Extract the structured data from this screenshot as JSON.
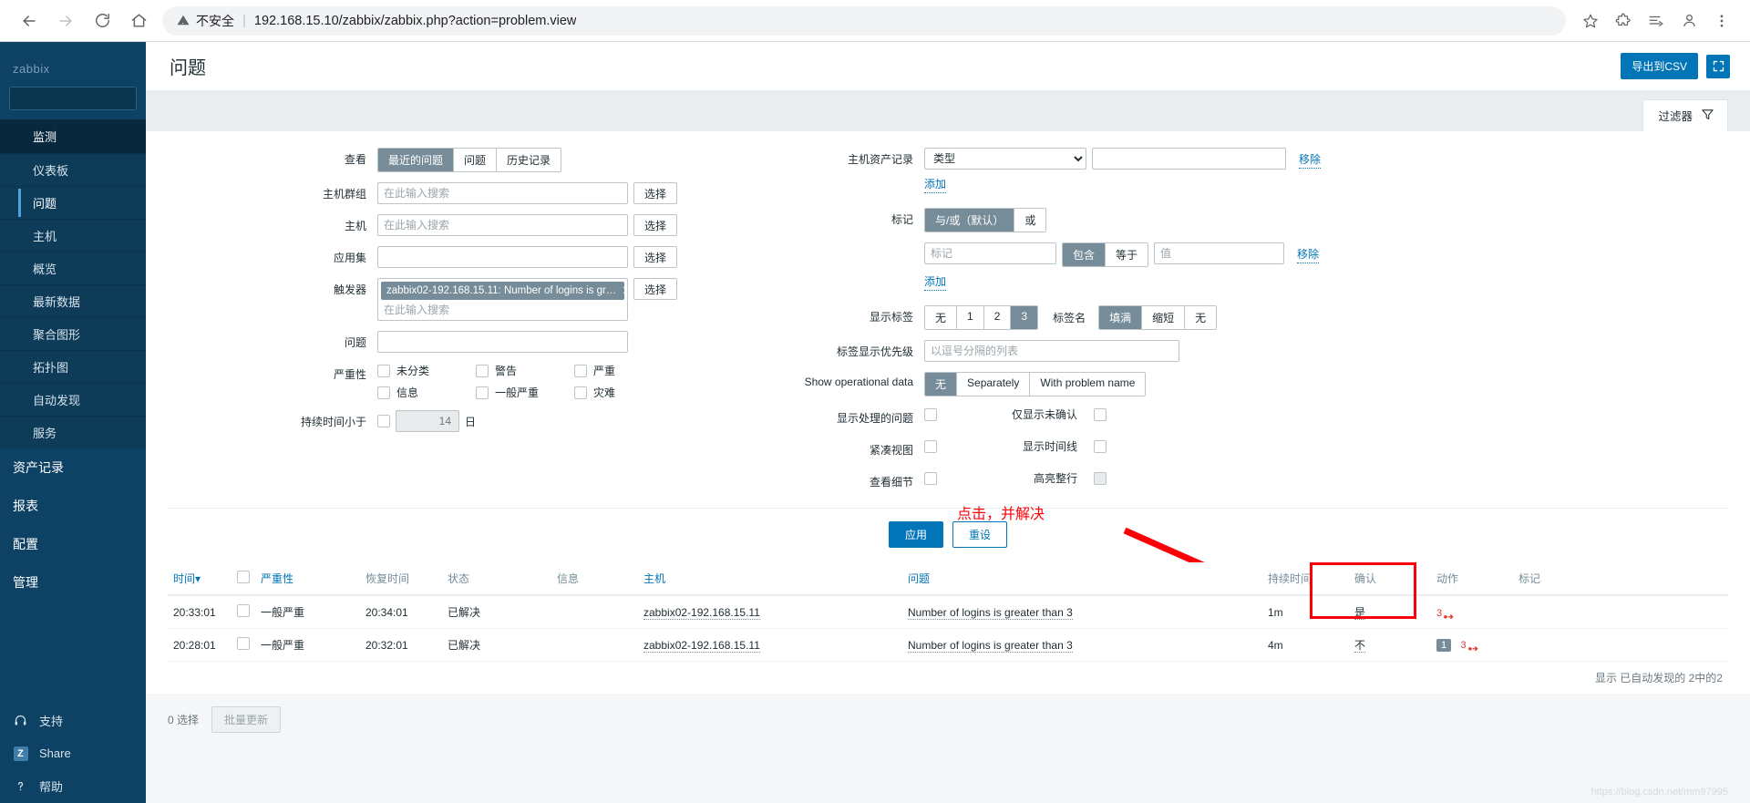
{
  "browser": {
    "back_icon": "back-arrow-icon",
    "forward_icon": "forward-arrow-icon",
    "reload_icon": "reload-icon",
    "home_icon": "home-icon",
    "warning_icon": "warning-triangle-icon",
    "security_label": "不安全",
    "url": "192.168.15.10/zabbix/zabbix.php?action=problem.view",
    "star_icon": "bookmark-star-icon",
    "extensions_icon": "puzzle-extensions-icon",
    "collections_icon": "collections-icon",
    "profile_icon": "profile-avatar-icon",
    "menu_icon": "three-dot-menu-icon"
  },
  "sidebar": {
    "logo": "zabbix",
    "search_placeholder": "",
    "section_monitoring": "监测",
    "sub_items": [
      {
        "label": "仪表板",
        "current": false
      },
      {
        "label": "问题",
        "current": true
      },
      {
        "label": "主机",
        "current": false
      },
      {
        "label": "概览",
        "current": false
      },
      {
        "label": "最新数据",
        "current": false
      },
      {
        "label": "聚合图形",
        "current": false
      },
      {
        "label": "拓扑图",
        "current": false
      },
      {
        "label": "自动发现",
        "current": false
      },
      {
        "label": "服务",
        "current": false
      }
    ],
    "top_items": [
      {
        "label": "资产记录"
      },
      {
        "label": "报表"
      },
      {
        "label": "配置"
      },
      {
        "label": "管理"
      }
    ],
    "footer_items": [
      {
        "label": "支持",
        "icon": "headset-icon"
      },
      {
        "label": "Share",
        "icon": "zabbix-z-icon"
      },
      {
        "label": "帮助",
        "icon": "question-mark-icon"
      }
    ]
  },
  "header": {
    "title": "问题",
    "export_csv": "导出到CSV",
    "kiosk_icon": "fullscreen-expand-icon"
  },
  "filter_tab": {
    "label": "过滤器",
    "icon": "funnel-filter-icon"
  },
  "filter": {
    "view_label": "查看",
    "view_options": [
      "最近的问题",
      "问题",
      "历史记录"
    ],
    "view_selected": "最近的问题",
    "hostgroup_label": "主机群组",
    "hostgroup_placeholder": "在此输入搜索",
    "hostgroup_select": "选择",
    "host_label": "主机",
    "host_placeholder": "在此输入搜索",
    "host_select": "选择",
    "appset_label": "应用集",
    "appset_value": "",
    "appset_select": "选择",
    "trigger_label": "触发器",
    "trigger_chip": "zabbix02-192.168.15.11: Number of logins is gr…",
    "trigger_placeholder": "在此输入搜索",
    "trigger_select": "选择",
    "problem_label": "问题",
    "problem_value": "",
    "severity_label": "严重性",
    "severity_options": [
      {
        "label": "未分类",
        "checked": false
      },
      {
        "label": "警告",
        "checked": false
      },
      {
        "label": "严重",
        "checked": false
      },
      {
        "label": "信息",
        "checked": false
      },
      {
        "label": "一般严重",
        "checked": false
      },
      {
        "label": "灾难",
        "checked": false
      }
    ],
    "duration_label": "持续时间小于",
    "duration_checked": false,
    "duration_value": "14",
    "duration_unit": "日",
    "inventory_label": "主机资产记录",
    "inventory_select_value": "类型",
    "inventory_value": "",
    "inventory_remove": "移除",
    "inventory_add": "添加",
    "tags_label": "标记",
    "tags_evaltype_options": [
      "与/或（默认）",
      "或"
    ],
    "tags_evaltype_selected": "与/或（默认）",
    "tag_name_placeholder": "标记",
    "tag_operator_options": [
      "包含",
      "等于"
    ],
    "tag_operator_selected": "包含",
    "tag_value_placeholder": "值",
    "tag_remove": "移除",
    "tag_add": "添加",
    "show_tags_label": "显示标签",
    "show_tags_options": [
      "无",
      "1",
      "2",
      "3"
    ],
    "show_tags_selected": "3",
    "tag_name_label": "标签名",
    "tag_name_options": [
      "填满",
      "缩短",
      "无"
    ],
    "tag_name_selected": "填满",
    "tag_priority_label": "标签显示优先级",
    "tag_priority_placeholder": "以逗号分隔的列表",
    "opdata_label": "Show operational data",
    "opdata_options": [
      "无",
      "Separately",
      "With problem name"
    ],
    "opdata_selected": "无",
    "show_suppressed_label": "显示处理的问题",
    "show_suppressed_checked": false,
    "unack_only_label": "仅显示未确认",
    "unack_only_checked": false,
    "compact_label": "紧凑视图",
    "compact_checked": false,
    "timeline_label": "显示时间线",
    "timeline_checked": false,
    "details_label": "查看细节",
    "details_checked": false,
    "highlight_label": "高亮整行",
    "highlight_checked": false,
    "highlight_disabled": true,
    "apply": "应用",
    "reset": "重设"
  },
  "annotation": {
    "text": "点击，并解决",
    "color": "#fb0007"
  },
  "table": {
    "columns": [
      "时间",
      "",
      "严重性",
      "恢复时间",
      "状态",
      "信息",
      "主机",
      "问题",
      "持续时间",
      "确认",
      "动作",
      "标记"
    ],
    "sort_icon": "sort-desc-arrow-icon",
    "rows": [
      {
        "time": "20:33:01",
        "severity": "一般严重",
        "recovery_time": "20:34:01",
        "status": "已解决",
        "info": "",
        "host": "zabbix02-192.168.15.11",
        "problem": "Number of logins is greater than 3",
        "duration": "1m",
        "ack": "是",
        "ack_state": "yes",
        "action_count": "",
        "action_msg": "3",
        "tags": ""
      },
      {
        "time": "20:28:01",
        "severity": "一般严重",
        "recovery_time": "20:32:01",
        "status": "已解决",
        "info": "",
        "host": "zabbix02-192.168.15.11",
        "problem": "Number of logins is greater than 3",
        "duration": "4m",
        "ack": "不",
        "ack_state": "no",
        "action_count": "1",
        "action_msg": "3",
        "tags": ""
      }
    ],
    "footer": "显示 已自动发现的 2中的2"
  },
  "bulk": {
    "selected_text": "0 选择",
    "button": "批量更新"
  },
  "watermark": "https://blog.csdn.net/mm97995",
  "colors": {
    "accent": "#0275b8",
    "sidebar": "#0e4265",
    "segment_on": "#768d99",
    "resolved_green": "#29a634",
    "unack_red": "#e33734",
    "annotation_red": "#fb0007"
  }
}
